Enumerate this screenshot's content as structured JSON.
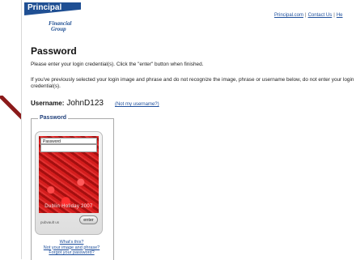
{
  "header": {
    "logo_brand": "Principal",
    "logo_sub_line1": "Financial",
    "logo_sub_line2": "Group",
    "links": [
      "Principal.com",
      "Contact Us",
      "He"
    ]
  },
  "main": {
    "title": "Password",
    "instruction": "Please enter your login credential(s). Click the \"enter\" button when finished.",
    "warning": "If you've previously selected your login image and phrase and do not recognize the image, phrase or username below, do not enter your login credential(s).",
    "username_label": "Username:",
    "username_value": "JohnD123",
    "not_my_username": "(Not my username?)"
  },
  "password_box": {
    "legend": "Password",
    "field_label": "Password",
    "field_value": "",
    "image_phrase": "Dublin Holiday 2007",
    "image_caption": "pubvault us",
    "enter_label": "enter",
    "links": [
      "What's this?",
      "Not your image and phrase?",
      "Forgot your password?"
    ]
  },
  "colors": {
    "brand_blue": "#1f4f93",
    "link": "#1e4f9c",
    "arrow": "#8b1a1a",
    "tulip_red": "#c81818"
  }
}
